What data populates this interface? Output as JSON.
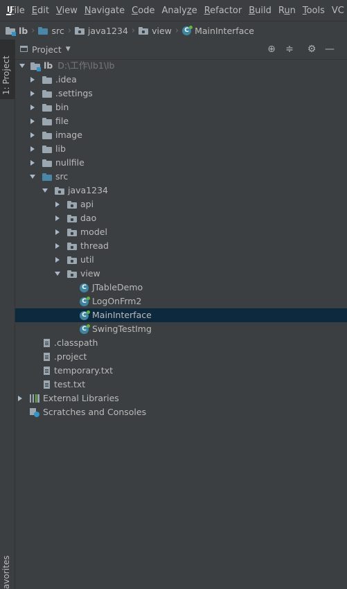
{
  "menubar": {
    "logo_text": "IJ",
    "items": [
      {
        "label": "File",
        "mnemonic": "F"
      },
      {
        "label": "Edit",
        "mnemonic": "E"
      },
      {
        "label": "View",
        "mnemonic": "V"
      },
      {
        "label": "Navigate",
        "mnemonic": "N"
      },
      {
        "label": "Code",
        "mnemonic": "C"
      },
      {
        "label": "Analyze",
        "mnemonic": "z"
      },
      {
        "label": "Refactor",
        "mnemonic": "R"
      },
      {
        "label": "Build",
        "mnemonic": "B"
      },
      {
        "label": "Run",
        "mnemonic": "u"
      },
      {
        "label": "Tools",
        "mnemonic": "T"
      },
      {
        "label": "VC",
        "mnemonic": "S"
      }
    ]
  },
  "breadcrumb": [
    "lb",
    "src",
    "java1234",
    "view",
    "MainInterface"
  ],
  "left_tools": {
    "project": "1: Project",
    "favorites": "avorites"
  },
  "project_panel": {
    "title": "Project",
    "root": {
      "name": "lb",
      "path": "D:\\工作\\lb1\\lb"
    },
    "items": [
      {
        "label": "External Libraries"
      },
      {
        "label": "Scratches and Consoles"
      }
    ]
  },
  "tree": {
    "folders": [
      ".idea",
      ".settings",
      "bin",
      "file",
      "image",
      "lib",
      "nullfile"
    ],
    "src": "src",
    "package": "java1234",
    "subpackages": [
      "api",
      "dao",
      "model",
      "thread",
      "util"
    ],
    "view": "view",
    "classes": [
      "JTableDemo",
      "LogOnFrm2",
      "MainInterface",
      "SwingTestImg"
    ],
    "selected_class": "MainInterface",
    "files": [
      ".classpath",
      ".project",
      "temporary.txt",
      "test.txt"
    ]
  },
  "colors": {
    "background": "#3c3f41",
    "selection": "#0d293e",
    "text": "#bbbbbb",
    "class_icon": "#3e86a0"
  }
}
